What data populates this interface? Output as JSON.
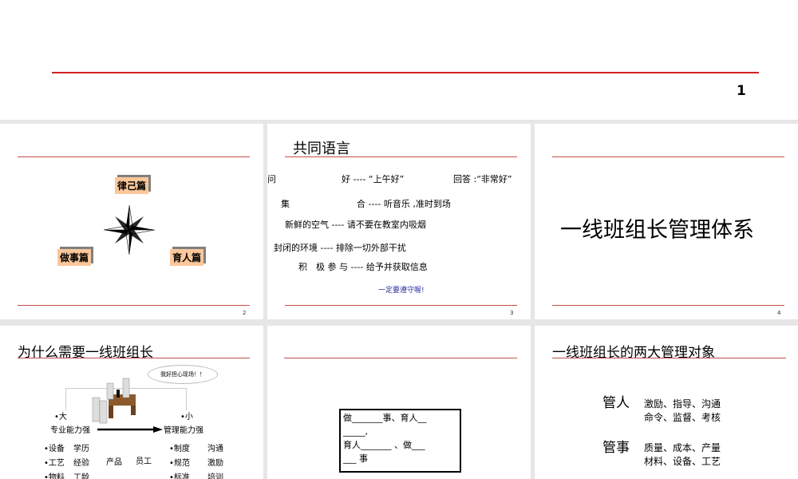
{
  "slide1": {
    "page": "1"
  },
  "slide2": {
    "labels": [
      "律己篇",
      "做事篇",
      "育人篇"
    ],
    "page": "2"
  },
  "slide3": {
    "title": "共同语言",
    "rows": [
      [
        "问",
        "好 ---- “上午好”",
        "回答 :“非常好”"
      ],
      [
        "集",
        "合 ---- 听音乐 ,准时到场"
      ],
      [
        "新鲜的空气 ---- 请不要在教室内吸烟"
      ],
      [
        "封闭的环境 ---- 排除一切外部干扰"
      ],
      [
        "积　极  参  与 ---- 给予并获取信息"
      ]
    ],
    "note": "一定要遵守喔!",
    "page": "3"
  },
  "slide4": {
    "title": "一线班组长管理体系",
    "page": "4"
  },
  "slide5": {
    "title": "为什么需要一线班组长",
    "bubble": "我好担心现场！！",
    "big": "•大",
    "big_sub": "专业能力强",
    "small": "•小",
    "small_sub": "管理能力强",
    "left": [
      [
        "•设备",
        "学历"
      ],
      [
        "•工艺",
        "经验"
      ],
      [
        "•物料",
        "工龄"
      ]
    ],
    "mid": [
      "产品",
      "员工"
    ],
    "right": [
      [
        "•制度",
        "沟通"
      ],
      [
        "•规范",
        "激励"
      ],
      [
        "•标准",
        "培训"
      ]
    ]
  },
  "slide6": {
    "lines": [
      "做_______事、育人__",
      "_____,",
      "育人_______ 、做___",
      "___ 事"
    ]
  },
  "slide7": {
    "title": "一线班组长的两大管理对象",
    "groups": [
      {
        "label": "管人",
        "items": [
          "激励、指导、沟通",
          "命令、监督、考核"
        ]
      },
      {
        "label": "管事",
        "items": [
          "质量、成本、产量",
          "材料、设备、工艺"
        ]
      }
    ]
  }
}
